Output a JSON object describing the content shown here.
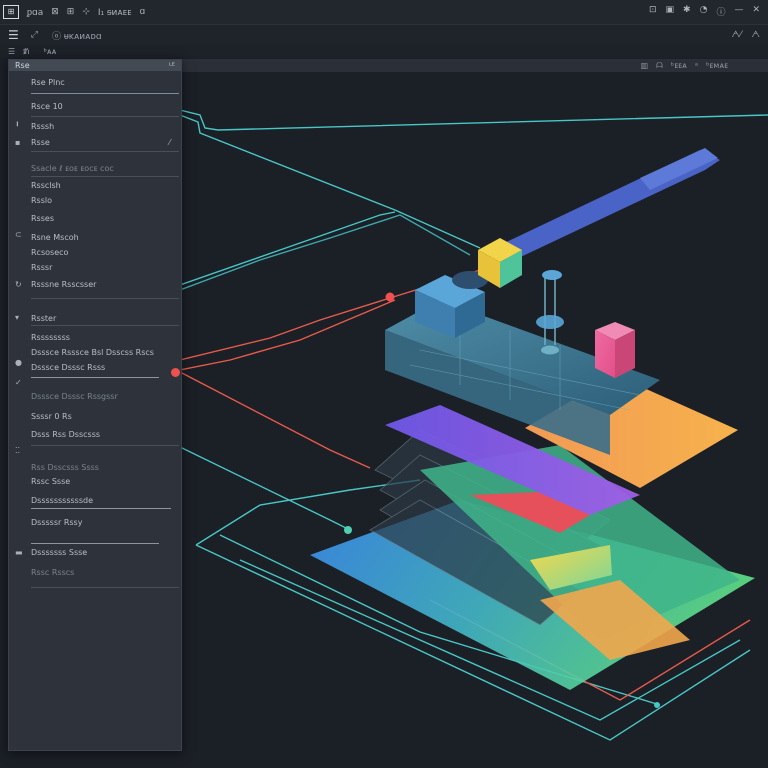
{
  "menubar": {
    "logo": "⊞",
    "items": [
      "ᵱɑa",
      "⊠",
      "⊞",
      "⊹",
      "Ⅰ₁ ᵴᴎᴀᴇᴇ",
      "ɑ"
    ],
    "right": [
      "⊡",
      "▣",
      "✱",
      "◔",
      "ⓘ",
      "—",
      "✕"
    ]
  },
  "toolbar": {
    "menu_icon": "☰",
    "tool_icon": "⤢",
    "label": "ⓞ ᵾᴋᴀᴎᴀᴅɑ",
    "right": [
      "ᗅ⁄",
      "ᗅ"
    ]
  },
  "tabrow": {
    "items": [
      "☰",
      "ᵺ",
      "ᵇᴀᴀ"
    ]
  },
  "subhead": {
    "right": [
      "▥",
      "ᗩ",
      "ᵇᴇᴇᴀ",
      "ᵃ",
      "ᵇᴇᴍᴀᴇ"
    ]
  },
  "panel": {
    "title": "Rse",
    "value": "ᴸᴱ"
  },
  "rows": [
    "Rse Plnc",
    "Rsce 10",
    "Rsssh",
    "Rsse",
    "Ssacle ℓ ᴇᴏᴇ ᴇᴏᴄᴇ ᴄᴏᴄ",
    "Rssclsh",
    "Rsslo",
    "Rsses",
    "Rsne Mscoh",
    "Rcsoseco",
    "Rsssr",
    "Rsssne Rsscsser",
    "Rsster",
    "Rssssssss",
    "Dsssce Rsssce Bsl Dsscss Rscs",
    "Dsssce Dsssc Rsss",
    "Dsssce Dsssc Rssgssr",
    "Ssssr 0 Rs",
    "Dsss Rss Dsscsss",
    "Rss Dsscsss  Ssss",
    "Rssc Ssse",
    "Dsssssssssssde",
    "Dsssssr Rssy",
    "Dsssssss Ssse",
    "Rssc Rsscs"
  ]
}
